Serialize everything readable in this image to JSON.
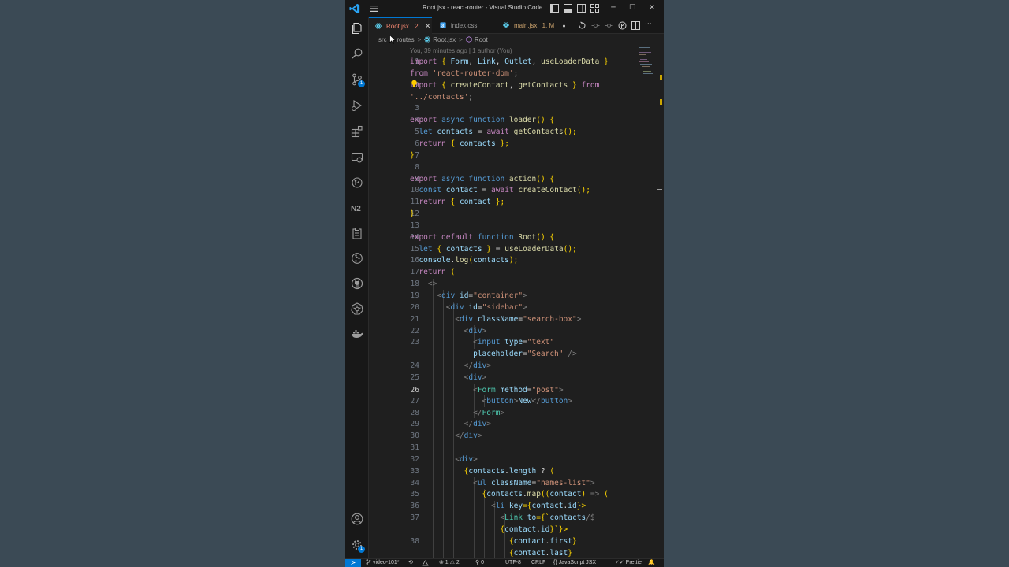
{
  "window": {
    "title": "Root.jsx - react-router - Visual Studio Code"
  },
  "titlebar_icons": [
    "layout-sidebar-left-icon",
    "layout-panel-icon",
    "layout-sidebar-right-icon",
    "customize-layout-icon"
  ],
  "window_controls": {
    "minimize": "─",
    "maximize": "☐",
    "close": "✕"
  },
  "activity_bar": {
    "items": [
      {
        "name": "explorer",
        "icon": "files-icon"
      },
      {
        "name": "search",
        "icon": "search-icon"
      },
      {
        "name": "source-control",
        "icon": "source-control-icon",
        "badge": "1"
      },
      {
        "name": "run-debug",
        "icon": "run-debug-icon"
      },
      {
        "name": "extensions",
        "icon": "extensions-icon"
      },
      {
        "name": "remote-explorer",
        "icon": "remote-explorer-icon"
      },
      {
        "name": "gitlens",
        "icon": "gitlens-icon"
      },
      {
        "name": "n2",
        "icon": "n2-icon"
      },
      {
        "name": "clipboard",
        "icon": "clipboard-icon"
      },
      {
        "name": "git-graph",
        "icon": "git-graph-icon"
      },
      {
        "name": "github",
        "icon": "github-icon"
      },
      {
        "name": "kubernetes",
        "icon": "kubernetes-icon"
      },
      {
        "name": "docker",
        "icon": "docker-icon"
      }
    ],
    "bottom": [
      {
        "name": "accounts",
        "icon": "account-icon"
      },
      {
        "name": "manage",
        "icon": "gear-icon",
        "badge": "1"
      }
    ]
  },
  "tabs": [
    {
      "label": "Root.jsx",
      "badge": "2",
      "active": true,
      "close": "✕"
    },
    {
      "label": "index.css",
      "badge": "",
      "active": false
    },
    {
      "label": "main.jsx",
      "badge": "1, M",
      "active": false,
      "dirty": "●"
    }
  ],
  "tab_actions": [
    "open-changes-icon",
    "previous-change-icon",
    "next-change-icon",
    "git-lens-icon",
    "split-editor-icon",
    "more-actions-icon"
  ],
  "more_actions_label": "···",
  "breadcrumb": {
    "items": [
      "src",
      "routes",
      "Root.jsx",
      "Root"
    ],
    "separator": ">"
  },
  "blame": "You, 39 minutes ago | 1 author (You)",
  "editor": {
    "current_line": 26,
    "lines": [
      {
        "num": "1",
        "code": "import { Form, Link, Outlet, useLoaderData }"
      },
      {
        "num": "",
        "code": "from 'react-router-dom';"
      },
      {
        "num": "2",
        "code": "import { createContact, getContacts } from"
      },
      {
        "num": "",
        "code": "'../contacts';"
      },
      {
        "num": "3",
        "code": ""
      },
      {
        "num": "4",
        "code": "export async function loader() {"
      },
      {
        "num": "5",
        "code": "  let contacts = await getContacts();"
      },
      {
        "num": "6",
        "code": "  return { contacts };"
      },
      {
        "num": "7",
        "code": "}"
      },
      {
        "num": "8",
        "code": ""
      },
      {
        "num": "9",
        "code": "export async function action() {"
      },
      {
        "num": "10",
        "code": "  const contact = await createContact();"
      },
      {
        "num": "11",
        "code": "  return { contact };"
      },
      {
        "num": "12",
        "code": "}"
      },
      {
        "num": "13",
        "code": ""
      },
      {
        "num": "14",
        "code": "export default function Root() {"
      },
      {
        "num": "15",
        "code": "  let { contacts } = useLoaderData();"
      },
      {
        "num": "16",
        "code": "  console.log(contacts);"
      },
      {
        "num": "17",
        "code": "  return ("
      },
      {
        "num": "18",
        "code": "    <>"
      },
      {
        "num": "19",
        "code": "      <div id=\"container\">"
      },
      {
        "num": "20",
        "code": "        <div id=\"sidebar\">"
      },
      {
        "num": "21",
        "code": "          <div className=\"search-box\">"
      },
      {
        "num": "22",
        "code": "            <div>"
      },
      {
        "num": "23",
        "code": "              <input type=\"text\""
      },
      {
        "num": "",
        "code": "              placeholder=\"Search\" />"
      },
      {
        "num": "24",
        "code": "            </div>"
      },
      {
        "num": "25",
        "code": "            <div>"
      },
      {
        "num": "26",
        "code": "              <Form method=\"post\">"
      },
      {
        "num": "27",
        "code": "                <button>New</button>"
      },
      {
        "num": "28",
        "code": "              </Form>"
      },
      {
        "num": "29",
        "code": "            </div>"
      },
      {
        "num": "30",
        "code": "          </div>"
      },
      {
        "num": "31",
        "code": ""
      },
      {
        "num": "32",
        "code": "          <div>"
      },
      {
        "num": "33",
        "code": "            {contacts.length ? ("
      },
      {
        "num": "34",
        "code": "              <ul className=\"names-list\">"
      },
      {
        "num": "35",
        "code": "                {contacts.map((contact) => ("
      },
      {
        "num": "36",
        "code": "                  <li key={contact.id}>"
      },
      {
        "num": "37",
        "code": "                    <Link to={`contacts/$"
      },
      {
        "num": "",
        "code": "                    {contact.id}`}>"
      },
      {
        "num": "38",
        "code": "                      {contact.first}"
      },
      {
        "num": "",
        "code": "                      {contact.last}"
      }
    ]
  },
  "statusbar": {
    "remote": "≻",
    "branch": "video-101*",
    "sync": "⟲",
    "errors": "⊗ 1",
    "warnings": "⚠ 2",
    "ports": "⚲ 0",
    "encoding": "UTF-8",
    "eol": "CRLF",
    "language_braces": "{}",
    "language": "JavaScript JSX",
    "formatter": "✓✓ Prettier",
    "notifications": "🔔"
  },
  "colors": {
    "accent": "#0078d4",
    "editor_bg": "#1f1f1f",
    "chrome_bg": "#181818",
    "page_bg": "#3b4a55",
    "modified": "#e2c08d",
    "error_tab": "#f48771"
  }
}
